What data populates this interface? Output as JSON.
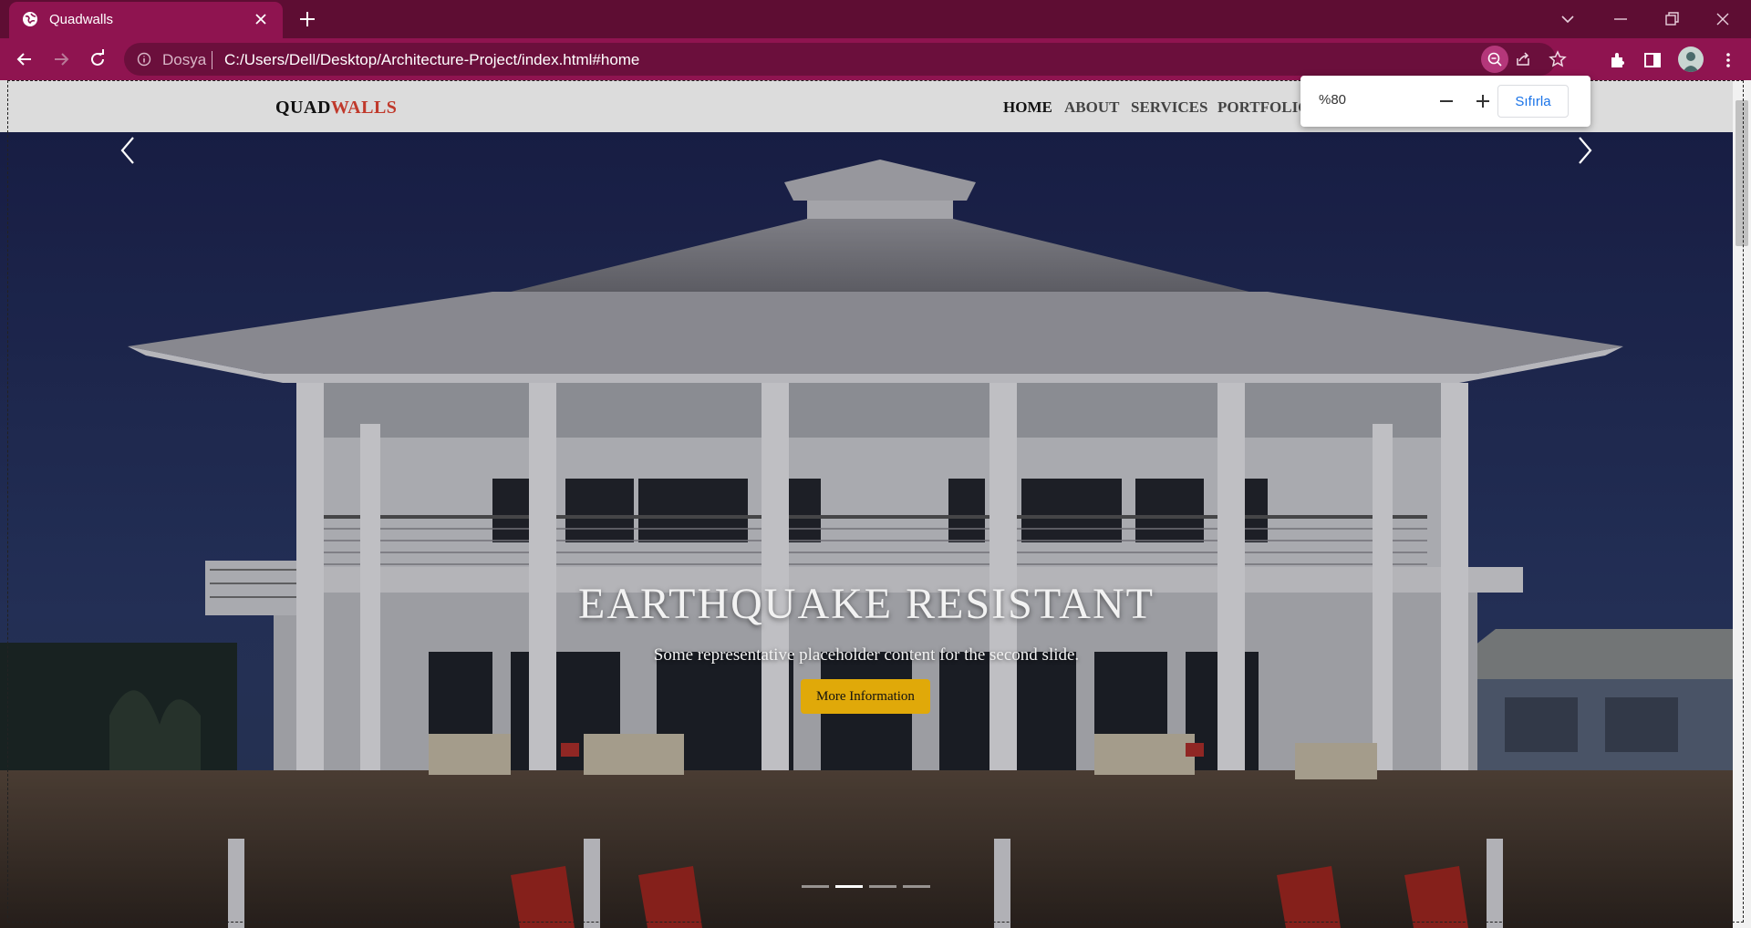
{
  "browser": {
    "tab_title": "Quadwalls",
    "address_scheme": "Dosya",
    "address_url": "C:/Users/Dell/Desktop/Architecture-Project/index.html#home",
    "zoom_popup": {
      "value": "%80",
      "reset_label": "Sıfırla"
    },
    "theme_color": "#8f1450"
  },
  "site": {
    "logo_part1": "QUAD",
    "logo_part2": "WALLS",
    "menu": [
      "HOME",
      "ABOUT",
      "SERVICES",
      "PORTFOLIO"
    ],
    "active_menu": "HOME"
  },
  "hero": {
    "title": "EARTHQUAKE RESISTANT",
    "text": "Some representative placeholder content for the second slide.",
    "button_label": "More Information",
    "slide_count": 4,
    "active_slide": 2,
    "accent_color": "#e0a909"
  }
}
